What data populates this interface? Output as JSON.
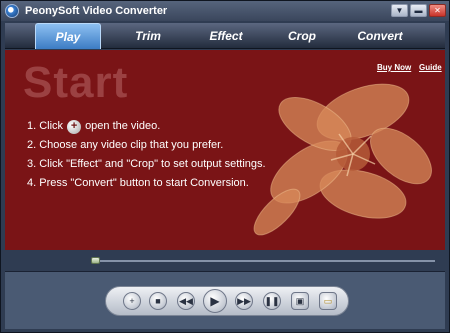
{
  "window": {
    "title": "PeonySoft Video Converter",
    "controls": {
      "minimize_icon": "▼",
      "restore_icon": "▬",
      "close_icon": "✕"
    }
  },
  "tabs": [
    {
      "label": "Play",
      "active": true
    },
    {
      "label": "Trim",
      "active": false
    },
    {
      "label": "Effect",
      "active": false
    },
    {
      "label": "Crop",
      "active": false
    },
    {
      "label": "Convert",
      "active": false
    }
  ],
  "content": {
    "heading": "Start",
    "links": {
      "buy_now": "Buy Now",
      "guide": "Guide"
    },
    "steps": {
      "step1_before": "1. Click",
      "step1_icon": "+",
      "step1_after": "open the video.",
      "step2": "2. Choose any video clip that you prefer.",
      "step3": "3. Click \"Effect\" and \"Crop\" to set output settings.",
      "step4": "4. Press \"Convert\" button to start Conversion."
    },
    "colors": {
      "background": "#7a1416",
      "flower": "#d88a5a"
    }
  },
  "seek": {
    "position": 0.0
  },
  "player_controls": {
    "icons": {
      "add": "+",
      "stop": "■",
      "rewind": "◀◀",
      "play": "▶",
      "fast_forward": "▶▶",
      "pause": "❚❚",
      "snapshot": "▣",
      "open_folder": "▭"
    }
  }
}
